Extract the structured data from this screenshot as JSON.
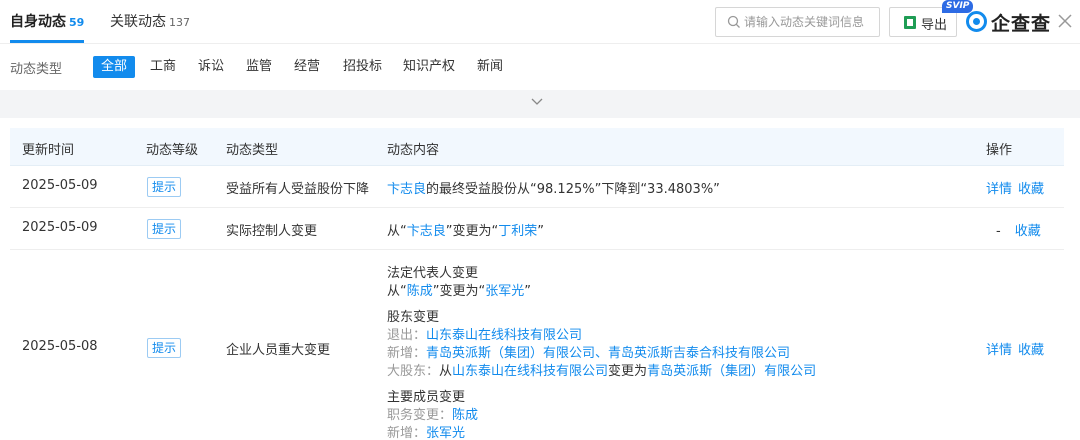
{
  "tabs": {
    "own": {
      "label": "自身动态",
      "count": "59"
    },
    "related": {
      "label": "关联动态",
      "count": "137"
    }
  },
  "search": {
    "placeholder": "请输入动态关键词信息"
  },
  "export": {
    "label": "导出",
    "badge": "SVIP"
  },
  "logo": {
    "text": "企查查"
  },
  "filter": {
    "caption": "动态类型",
    "chips": [
      "全部",
      "工商",
      "诉讼",
      "监管",
      "经营",
      "招投标",
      "知识产权",
      "新闻"
    ]
  },
  "table": {
    "headers": [
      "更新时间",
      "动态等级",
      "动态类型",
      "动态内容",
      "操作"
    ],
    "rows": [
      {
        "date": "2025-05-09",
        "level": "提示",
        "type": "受益所有人受益股份下降",
        "content": {
          "person": "卞志良",
          "text": "的最终受益股份从“98.125%”下降到“33.4803%”"
        },
        "op_detail": "详情",
        "op_fav": "收藏"
      },
      {
        "date": "2025-05-09",
        "level": "提示",
        "type": "实际控制人变更",
        "content": {
          "pre": "从“",
          "from": "卞志良",
          "mid": "”变更为“",
          "to": "丁利荣",
          "post": "”"
        },
        "op_detail": "-",
        "op_fav": "收藏"
      },
      {
        "date": "2025-05-08",
        "level": "提示",
        "type": "企业人员重大变更",
        "content": {
          "legal_title": "法定代表人变更",
          "legal_pre": "从“",
          "legal_from": "陈成",
          "legal_mid": "”变更为“",
          "legal_to": "张军光",
          "legal_post": "”",
          "sh_title": "股东变更",
          "sh_exit_label": "退出：",
          "sh_exit": "山东泰山在线科技有限公司",
          "sh_add_label": "新增：",
          "sh_add_1": "青岛英派斯（集团）有限公司",
          "sh_add_sep": "、",
          "sh_add_2": "青岛英派斯吉泰合科技有限公司",
          "sh_major_label": "大股东：",
          "sh_major_pre": "从",
          "sh_major_from": "山东泰山在线科技有限公司",
          "sh_major_mid": "变更为",
          "sh_major_to": "青岛英派斯（集团）有限公司",
          "mem_title": "主要成员变更",
          "mem_change_label": "职务变更：",
          "mem_change": "陈成",
          "mem_add_label": "新增：",
          "mem_add": "张军光"
        },
        "op_detail": "详情",
        "op_fav": "收藏"
      }
    ]
  },
  "colors": {
    "accent": "#128bed",
    "header_bg": "#f2f8fe",
    "strip_bg": "#f3f4f6"
  }
}
